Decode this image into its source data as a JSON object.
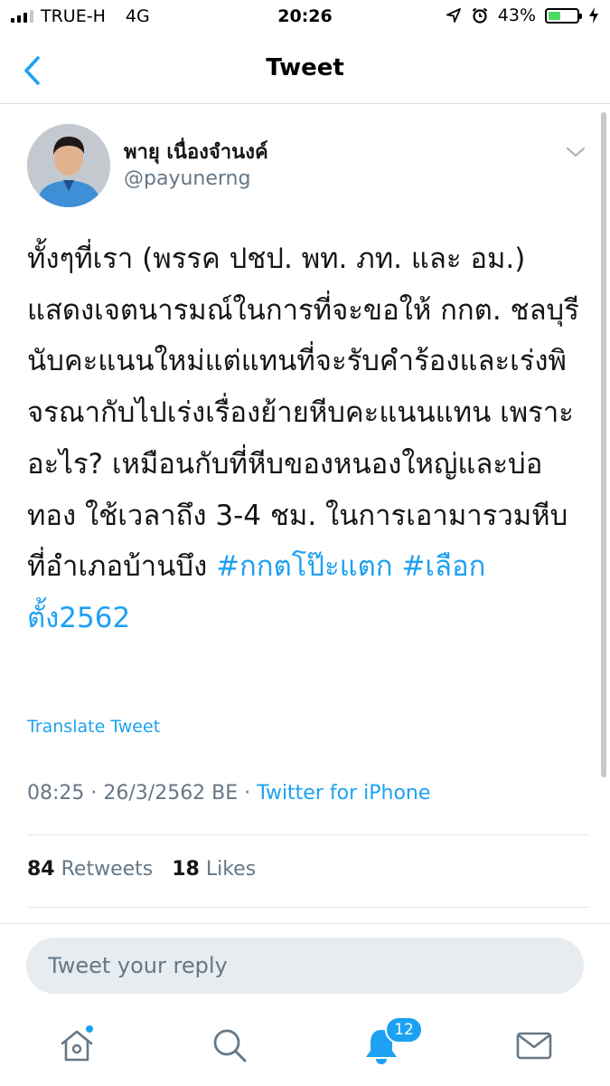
{
  "status_bar": {
    "carrier": "TRUE-H",
    "network": "4G",
    "time": "20:26",
    "battery_percent": "43%",
    "battery_level": 0.43
  },
  "nav": {
    "title": "Tweet"
  },
  "tweet": {
    "author_name": "พายุ เนื่องจำนงค์",
    "author_handle": "@payunerng",
    "text": "ทั้งๆที่เรา (พรรค ปชป. พท. ภท. และ อม.) แสดงเจตนารมณ์ในการที่จะขอให้ กกต. ชลบุรีนับคะแนนใหม่แต่แทนที่จะรับคำร้องและเร่งพิจรณากับไปเร่งเรื่องย้ายหีบคะแนนแทน เพราะอะไร? เหมือนกับที่หีบของหนองใหญ่และบ่อทอง ใช้เวลาถึง 3-4 ชม. ในการเอามารวมหีบที่อำเภอบ้านบึง ",
    "hashtag_1": "#กกตโป๊ะแตก",
    "hashtag_2": "#เลือกตั้ง2562",
    "translate_label": "Translate Tweet",
    "timestamp": "08:25 · 26/3/2562 BE · ",
    "source": "Twitter for iPhone",
    "retweets_count": "84",
    "retweets_label": "Retweets",
    "likes_count": "18",
    "likes_label": "Likes"
  },
  "reply": {
    "placeholder": "Tweet your reply"
  },
  "tab_bar": {
    "notifications_badge": "12"
  },
  "colors": {
    "accent": "#1da1f2",
    "secondary_text": "#657786",
    "primary_text": "#14171a",
    "battery_fill": "#4cd964"
  },
  "icons": [
    "back-chevron-icon",
    "caret-down-icon",
    "home-icon",
    "search-icon",
    "bell-icon",
    "mail-icon",
    "location-arrow-icon",
    "alarm-icon",
    "charging-bolt-icon"
  ]
}
